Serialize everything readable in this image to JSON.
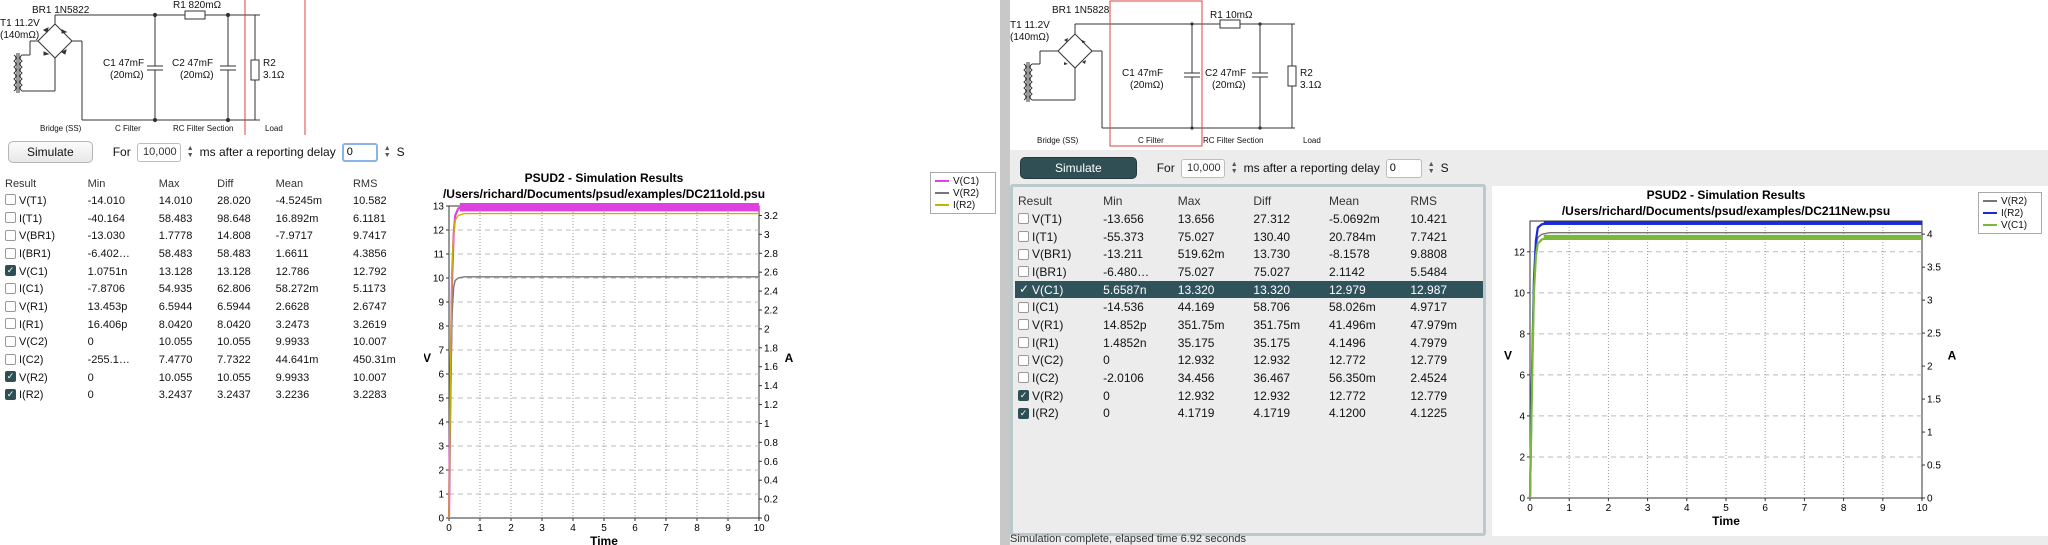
{
  "left": {
    "circuit": {
      "transformer": "T1 11.2V",
      "transformer_res": "(140mΩ)",
      "bridge": "BR1 1N5822",
      "r1": "R1 820mΩ",
      "c1": "C1 47mF",
      "c1_res": "(20mΩ)",
      "c2": "C2 47mF",
      "c2_res": "(20mΩ)",
      "r2": "R2",
      "r2_val": "3.1Ω",
      "sections": [
        "Bridge (SS)",
        "C Filter",
        "RC Filter Section",
        "Load"
      ]
    },
    "controls": {
      "simulate": "Simulate",
      "for_label": "For",
      "duration": "10,000",
      "after": "ms  after a reporting delay",
      "delay": "0",
      "unit": "S"
    },
    "table": {
      "headers": [
        "Result",
        "Min",
        "Max",
        "Diff",
        "Mean",
        "RMS"
      ],
      "rows": [
        {
          "name": "V(T1)",
          "checked": false,
          "min": "-14.010",
          "max": "14.010",
          "diff": "28.020",
          "mean": "-4.5245m",
          "rms": "10.582"
        },
        {
          "name": "I(T1)",
          "checked": false,
          "min": "-40.164",
          "max": "58.483",
          "diff": "98.648",
          "mean": "16.892m",
          "rms": "6.1181"
        },
        {
          "name": "V(BR1)",
          "checked": false,
          "min": "-13.030",
          "max": "1.7778",
          "diff": "14.808",
          "mean": "-7.9717",
          "rms": "9.7417"
        },
        {
          "name": "I(BR1)",
          "checked": false,
          "min": "-6.402…",
          "max": "58.483",
          "diff": "58.483",
          "mean": "1.6611",
          "rms": "4.3856"
        },
        {
          "name": "V(C1)",
          "checked": true,
          "min": "1.0751n",
          "max": "13.128",
          "diff": "13.128",
          "mean": "12.786",
          "rms": "12.792"
        },
        {
          "name": "I(C1)",
          "checked": false,
          "min": "-7.8706",
          "max": "54.935",
          "diff": "62.806",
          "mean": "58.272m",
          "rms": "5.1173"
        },
        {
          "name": "V(R1)",
          "checked": false,
          "min": "13.453p",
          "max": "6.5944",
          "diff": "6.5944",
          "mean": "2.6628",
          "rms": "2.6747"
        },
        {
          "name": "I(R1)",
          "checked": false,
          "min": "16.406p",
          "max": "8.0420",
          "diff": "8.0420",
          "mean": "3.2473",
          "rms": "3.2619"
        },
        {
          "name": "V(C2)",
          "checked": false,
          "min": "0",
          "max": "10.055",
          "diff": "10.055",
          "mean": "9.9933",
          "rms": "10.007"
        },
        {
          "name": "I(C2)",
          "checked": false,
          "min": "-255.1…",
          "max": "7.4770",
          "diff": "7.7322",
          "mean": "44.641m",
          "rms": "450.31m"
        },
        {
          "name": "V(R2)",
          "checked": true,
          "min": "0",
          "max": "10.055",
          "diff": "10.055",
          "mean": "9.9933",
          "rms": "10.007"
        },
        {
          "name": "I(R2)",
          "checked": true,
          "min": "0",
          "max": "3.2437",
          "diff": "3.2437",
          "mean": "3.2236",
          "rms": "3.2283"
        }
      ]
    },
    "chart_data": {
      "type": "line",
      "title": "PSUD2 - Simulation Results",
      "subtitle": "/Users/richard/Documents/psud/examples/DC211old.psu",
      "xlabel": "Time",
      "ylabel": "V",
      "y2label": "A",
      "xlim": [
        0,
        10
      ],
      "ylim": [
        0,
        13
      ],
      "y2lim": [
        0,
        3.3
      ],
      "xticks": [
        "0",
        "1",
        "2",
        "3",
        "4",
        "5",
        "6",
        "7",
        "8",
        "9",
        "10"
      ],
      "yticks": [
        "0",
        "1",
        "2",
        "3",
        "4",
        "5",
        "6",
        "7",
        "8",
        "9",
        "10",
        "11",
        "12",
        "13"
      ],
      "y2ticks": [
        "0",
        "0.2",
        "0.4",
        "0.6",
        "0.8",
        "1",
        "1.2",
        "1.4",
        "1.6",
        "1.8",
        "2",
        "2.2",
        "2.4",
        "2.6",
        "2.8",
        "3",
        "3.2"
      ],
      "grid": true,
      "legend_position": "top-right",
      "series": [
        {
          "name": "V(C1)",
          "color": "#e040e0",
          "axis": "left",
          "x": [
            0,
            0.05,
            0.1,
            0.15,
            0.2,
            0.3,
            0.5,
            10
          ],
          "y": [
            0,
            6,
            10,
            11.8,
            12.6,
            12.9,
            12.95,
            12.95
          ],
          "ripple": 0.35
        },
        {
          "name": "V(R2)",
          "color": "#777777",
          "axis": "left",
          "x": [
            0,
            0.05,
            0.1,
            0.15,
            0.2,
            0.3,
            0.5,
            10
          ],
          "y": [
            0,
            5,
            8.5,
            9.6,
            9.9,
            10.0,
            10.05,
            10.05
          ],
          "ripple": 0
        },
        {
          "name": "I(R2)",
          "color": "#c8b400",
          "axis": "right",
          "x": [
            0,
            0.05,
            0.1,
            0.15,
            0.2,
            0.3,
            0.5,
            10
          ],
          "y": [
            0,
            1.6,
            2.7,
            3.0,
            3.15,
            3.2,
            3.22,
            3.22
          ],
          "ripple": 0
        }
      ]
    }
  },
  "right": {
    "circuit": {
      "transformer": "T1 11.2V",
      "transformer_res": "(140mΩ)",
      "bridge": "BR1 1N5828",
      "r1": "R1 10mΩ",
      "c1": "C1 47mF",
      "c1_res": "(20mΩ)",
      "c2": "C2 47mF",
      "c2_res": "(20mΩ)",
      "r2": "R2",
      "r2_val": "3.1Ω",
      "sections": [
        "Bridge (SS)",
        "C Filter",
        "RC Filter Section",
        "Load"
      ]
    },
    "controls": {
      "simulate": "Simulate",
      "for_label": "For",
      "duration": "10,000",
      "after": "ms  after a reporting delay",
      "delay": "0",
      "unit": "S"
    },
    "table": {
      "headers": [
        "Result",
        "Min",
        "Max",
        "Diff",
        "Mean",
        "RMS"
      ],
      "rows": [
        {
          "name": "V(T1)",
          "checked": false,
          "min": "-13.656",
          "max": "13.656",
          "diff": "27.312",
          "mean": "-5.0692m",
          "rms": "10.421"
        },
        {
          "name": "I(T1)",
          "checked": false,
          "min": "-55.373",
          "max": "75.027",
          "diff": "130.40",
          "mean": "20.784m",
          "rms": "7.7421"
        },
        {
          "name": "V(BR1)",
          "checked": false,
          "min": "-13.211",
          "max": "519.62m",
          "diff": "13.730",
          "mean": "-8.1578",
          "rms": "9.8808"
        },
        {
          "name": "I(BR1)",
          "checked": false,
          "min": "-6.480…",
          "max": "75.027",
          "diff": "75.027",
          "mean": "2.1142",
          "rms": "5.5484"
        },
        {
          "name": "V(C1)",
          "checked": true,
          "selected": true,
          "min": "5.6587n",
          "max": "13.320",
          "diff": "13.320",
          "mean": "12.979",
          "rms": "12.987"
        },
        {
          "name": "I(C1)",
          "checked": false,
          "min": "-14.536",
          "max": "44.169",
          "diff": "58.706",
          "mean": "58.026m",
          "rms": "4.9717"
        },
        {
          "name": "V(R1)",
          "checked": false,
          "min": "14.852p",
          "max": "351.75m",
          "diff": "351.75m",
          "mean": "41.496m",
          "rms": "47.979m"
        },
        {
          "name": "I(R1)",
          "checked": false,
          "min": "1.4852n",
          "max": "35.175",
          "diff": "35.175",
          "mean": "4.1496",
          "rms": "4.7979"
        },
        {
          "name": "V(C2)",
          "checked": false,
          "min": "0",
          "max": "12.932",
          "diff": "12.932",
          "mean": "12.772",
          "rms": "12.779"
        },
        {
          "name": "I(C2)",
          "checked": false,
          "min": "-2.0106",
          "max": "34.456",
          "diff": "36.467",
          "mean": "56.350m",
          "rms": "2.4524"
        },
        {
          "name": "V(R2)",
          "checked": true,
          "min": "0",
          "max": "12.932",
          "diff": "12.932",
          "mean": "12.772",
          "rms": "12.779"
        },
        {
          "name": "I(R2)",
          "checked": true,
          "min": "0",
          "max": "4.1719",
          "diff": "4.1719",
          "mean": "4.1200",
          "rms": "4.1225"
        }
      ]
    },
    "chart_data": {
      "type": "line",
      "title": "PSUD2 - Simulation Results",
      "subtitle": "/Users/richard/Documents/psud/examples/DC211New.psu",
      "xlabel": "Time",
      "ylabel": "V",
      "y2label": "A",
      "xlim": [
        0,
        10
      ],
      "ylim": [
        0,
        13.5
      ],
      "y2lim": [
        0,
        4.2
      ],
      "xticks": [
        "0",
        "1",
        "2",
        "3",
        "4",
        "5",
        "6",
        "7",
        "8",
        "9",
        "10"
      ],
      "yticks": [
        "0",
        "2",
        "4",
        "6",
        "8",
        "10",
        "12"
      ],
      "y2ticks": [
        "0",
        "0.5",
        "1",
        "1.5",
        "2",
        "2.5",
        "3",
        "3.5",
        "4"
      ],
      "grid": true,
      "legend_position": "top-right",
      "series": [
        {
          "name": "V(R2)",
          "color": "#777777",
          "axis": "left",
          "x": [
            0,
            0.05,
            0.1,
            0.15,
            0.2,
            0.3,
            0.5,
            10
          ],
          "y": [
            0,
            6,
            10.5,
            12.2,
            12.7,
            12.85,
            12.93,
            12.93
          ],
          "ripple": 0
        },
        {
          "name": "I(R2)",
          "color": "#1a2bd8",
          "axis": "right",
          "x": [
            0,
            0.05,
            0.1,
            0.15,
            0.2,
            0.3,
            0.5,
            10
          ],
          "y": [
            0,
            1.9,
            3.3,
            3.9,
            4.1,
            4.15,
            4.17,
            4.17
          ],
          "ripple": 0.06
        },
        {
          "name": "V(C1)",
          "color": "#79b83a",
          "axis": "left",
          "x": [
            0,
            0.05,
            0.1,
            0.15,
            0.2,
            0.3,
            0.5,
            10
          ],
          "y": [
            0,
            5.5,
            10,
            11.8,
            12.4,
            12.6,
            12.7,
            12.7
          ],
          "ripple": 0.25
        }
      ]
    },
    "status": "Simulation complete, elapsed time 6.92 seconds"
  }
}
